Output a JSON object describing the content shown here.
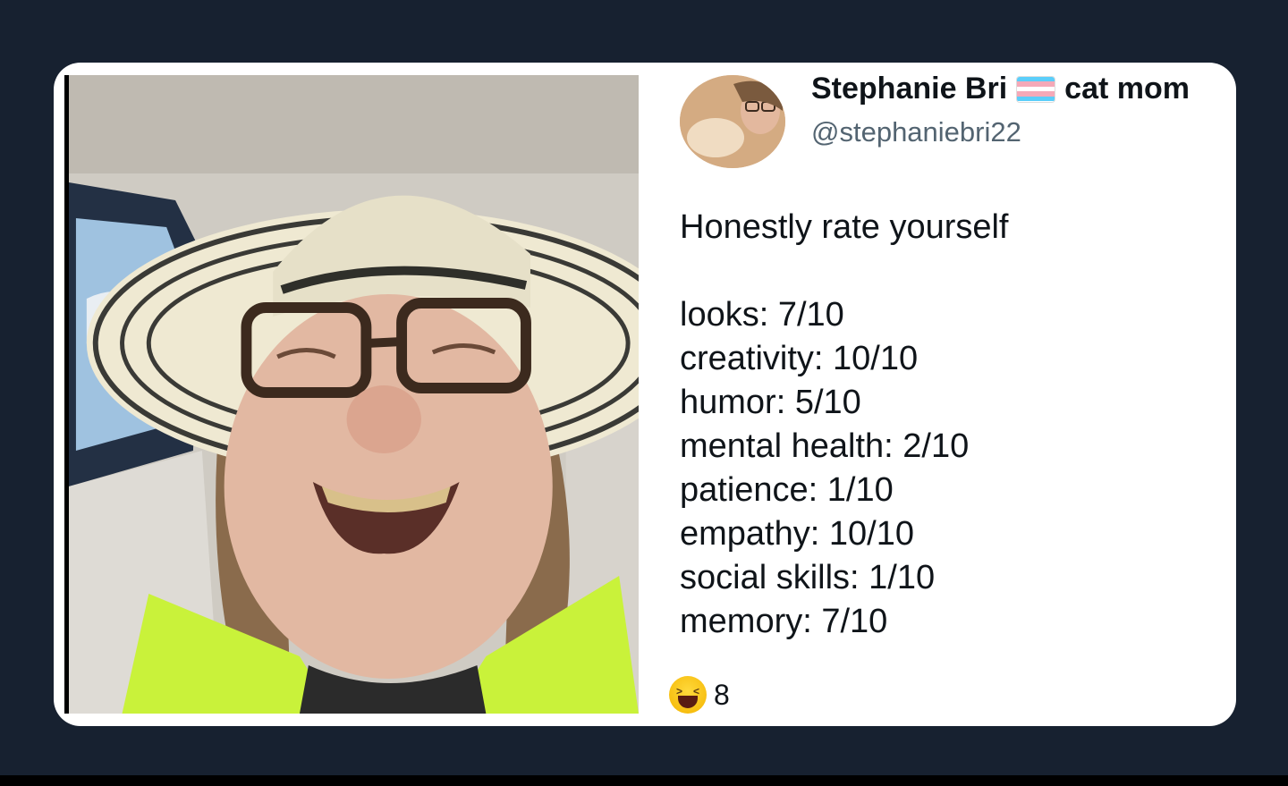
{
  "tweet": {
    "display_name": "Stephanie Bri",
    "name_suffix": "cat mom",
    "handle": "@stephaniebri22",
    "lead_text": "Honestly rate yourself",
    "ratings": [
      "looks: 7/10",
      "creativity: 10/10",
      "humor: 5/10",
      "mental health: 2/10",
      "patience: 1/10",
      "empathy: 10/10",
      "social skills: 1/10",
      "memory: 7/10"
    ],
    "reaction_count": "8",
    "reaction_icon": "laughing-emoji-icon",
    "flag_icon": "trans-flag-icon"
  },
  "colors": {
    "background": "#172130",
    "card": "#ffffff",
    "text": "#0f1419",
    "handle": "#536471",
    "flag_blue": "#5BCEFA",
    "flag_pink": "#F5A9B8",
    "flag_white": "#FFFFFF"
  }
}
